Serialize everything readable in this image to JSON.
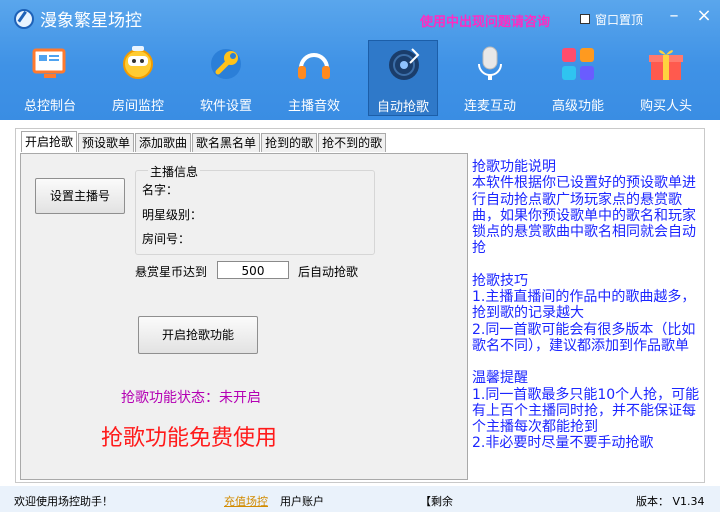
{
  "window": {
    "title": "漫象繁星场控",
    "consult_text": "使用中出现问题请咨询",
    "pin_label": "窗口置顶"
  },
  "nav": [
    {
      "label": "总控制台",
      "icon": "dashboard-icon"
    },
    {
      "label": "房间监控",
      "icon": "monitor-robot-icon"
    },
    {
      "label": "软件设置",
      "icon": "wrench-icon"
    },
    {
      "label": "主播音效",
      "icon": "headphones-icon"
    },
    {
      "label": "自动抢歌",
      "icon": "vinyl-record-icon",
      "active": true
    },
    {
      "label": "连麦互动",
      "icon": "microphone-icon"
    },
    {
      "label": "高级功能",
      "icon": "tiles-icon"
    },
    {
      "label": "购买人头",
      "icon": "gift-icon"
    }
  ],
  "tabs": [
    "开启抢歌",
    "预设歌单",
    "添加歌曲",
    "歌名黑名单",
    "抢到的歌",
    "抢不到的歌"
  ],
  "panel": {
    "set_host_button": "设置主播号",
    "host_info_title": "主播信息",
    "name_label": "名字：",
    "star_level_label": "明星级别：",
    "room_label": "房间号：",
    "reward_prefix": "悬赏星币达到",
    "reward_value": "500",
    "reward_suffix": "后自动抢歌",
    "start_button": "开启抢歌功能",
    "status": "抢歌功能状态：未开启",
    "free_text": "抢歌功能免费使用"
  },
  "help": {
    "title1": "抢歌功能说明",
    "desc": "本软件根据你已设置好的预设歌单进行自动抢点歌广场玩家点的悬赏歌曲，如果你预设歌单中的歌名和玩家锁点的悬赏歌曲中歌名相同就会自动抢",
    "title2": "抢歌技巧",
    "tip1": "1.主播直播间的作品中的歌曲越多，抢到歌的记录越大",
    "tip2": "2.同一首歌可能会有很多版本（比如歌名不同），建议都添加到作品歌单",
    "title3": "温馨提醒",
    "note1": "1.同一首歌最多只能10个人抢，可能有上百个主播同时抢，并不能保证每个主播每次都能抢到",
    "note2": "2.非必要时尽量不要手动抢歌"
  },
  "footer": {
    "welcome": "欢迎使用场控助手！",
    "recharge": "充值场控",
    "account": "用户账户",
    "remaining": "【剩余",
    "version": "版本： V1.34"
  }
}
